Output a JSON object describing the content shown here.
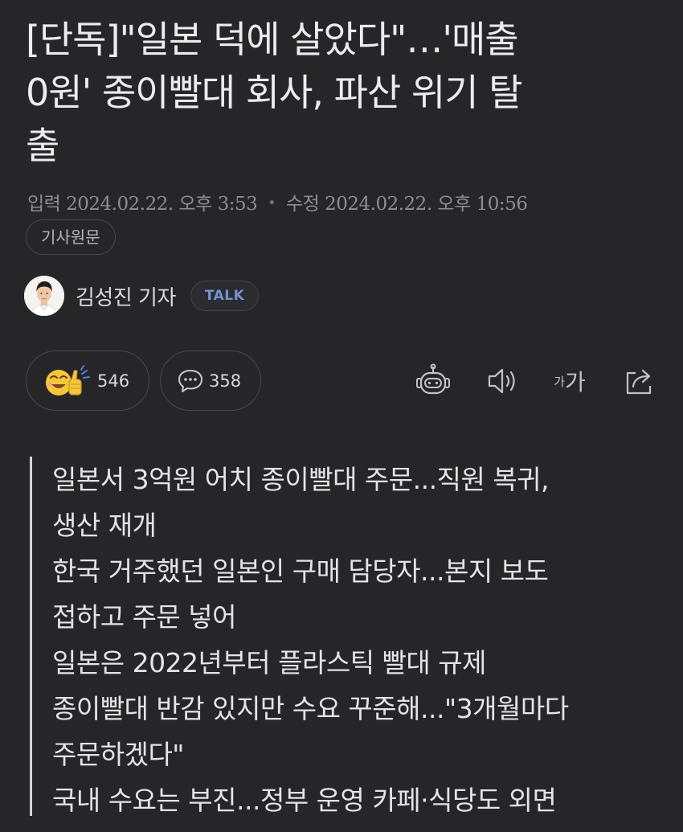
{
  "article": {
    "headline_line1": "[단독]\"일본 덕에 살았다\"…'매출",
    "headline_line2": "0원' 종이빨대 회사, 파산 위기 탈",
    "headline_line3": "출",
    "published_label": "입력",
    "published_value": "2024.02.22. 오후 3:53",
    "modified_label": "수정",
    "modified_value": "2024.02.22. 오후 10:56",
    "original_article_label": "기사원문"
  },
  "reporter": {
    "name": "김성진 기자",
    "talk_label": "TALK"
  },
  "engagement": {
    "reaction_count": "546",
    "comment_count": "358"
  },
  "toolbar": {
    "font_size_small": "가",
    "font_size_big": "가",
    "icons": [
      "robot-summary-icon",
      "speaker-icon",
      "font-size-icon",
      "share-icon"
    ]
  },
  "summary": {
    "lines": [
      "일본서 3억원 어치 종이빨대 주문...직원 복귀,",
      "생산 재개",
      "한국 거주했던 일본인 구매 담당자...본지 보도",
      "접하고 주문 넣어",
      "일본은 2022년부터 플라스틱 빨대 규제",
      "종이빨대 반감 있지만 수요 꾸준해...\"3개월마다",
      "주문하겠다\"",
      "국내 수요는 부진...정부 운영 카페·식당도 외면"
    ]
  },
  "colors": {
    "background": "#262629",
    "text": "#ececee",
    "muted": "#8d8d92",
    "talk_accent": "#7391d6",
    "emoji_yellow": "#f6c63a",
    "summary_bar": "#d4d4d8"
  }
}
